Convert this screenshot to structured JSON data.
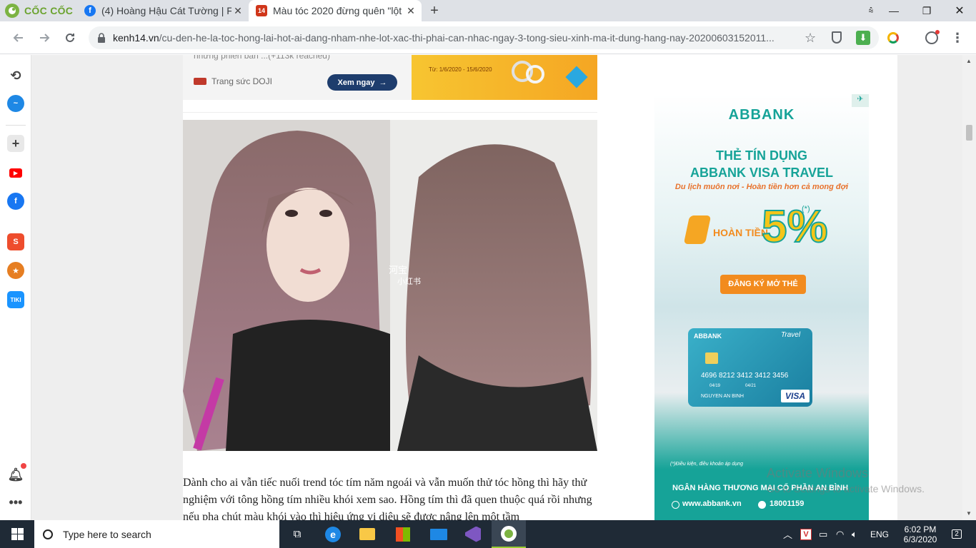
{
  "browser": {
    "brand": "CỐC CỐC",
    "tabs": [
      {
        "title": "(4) Hoàng Hậu Cát Tường | Fa"
      },
      {
        "title": "Màu tóc 2020 đừng quên \"lột"
      }
    ],
    "new_tab_label": "+",
    "url_domain": "kenh14.vn",
    "url_path": "/cu-den-he-la-toc-hong-lai-hot-ai-dang-nham-nhe-lot-xac-thi-phai-can-nhac-ngay-3-tong-sieu-xinh-ma-it-dung-hang-nay-20200603152011...",
    "notification_dot_color": "#f04444"
  },
  "promo": {
    "note": "những phiên bản ...(+113k reached)",
    "sponsor": "Trang sức DOJI",
    "cta": "Xem ngay",
    "dates": "Từ: 1/6/2020 - 15/6/2020",
    "dates_color": "#d35400"
  },
  "article": {
    "photo_caption_right": "小红书",
    "photo_watermark": "河宝",
    "paragraph": "Dành cho ai vẫn tiếc nuối trend tóc tím năm ngoái và vẫn muốn thử tóc hồng thì hãy thử nghiệm với tông hồng tím nhiều khói xem sao. Hồng tím thì đã quen thuộc quá rồi nhưng nếu pha chút màu khói vào thì hiệu ứng vi diệu sẽ được nâng lên một tầm"
  },
  "ad": {
    "brand": "ABBANK",
    "headline1": "THẺ TÍN DỤNG",
    "headline2": "ABBANK VISA TRAVEL",
    "tagline": "Du lịch muôn nơi - Hoàn tiền hơn cả mong đợi",
    "cashback_label": "HOÀN TIỀN",
    "cashback_value": "5%",
    "asterisk": "(*)",
    "cta": "ĐĂNG KÝ MỞ THẺ",
    "card_brand": "ABBANK",
    "card_type": "Travel",
    "card_number": "4696 8212 3412 3412 3456",
    "card_holder": "NGUYEN AN BINH",
    "card_valid_from": "04/19",
    "card_valid_to": "04/21",
    "card_network": "VISA",
    "terms": "(*)Điều kiện, điều khoản áp dụng",
    "bank_name": "NGÂN HÀNG THƯƠNG MẠI CỔ PHẦN AN BÌNH",
    "website": "www.abbank.vn",
    "hotline": "18001159",
    "teal": "#16a398",
    "orange": "#f28b1e"
  },
  "watermark": {
    "line1": "Activate Windows",
    "line2": "Go to Settings to activate Windows."
  },
  "taskbar": {
    "search_placeholder": "Type here to search",
    "lang": "ENG",
    "time": "6:02 PM",
    "date": "6/3/2020",
    "notifications": "2"
  }
}
